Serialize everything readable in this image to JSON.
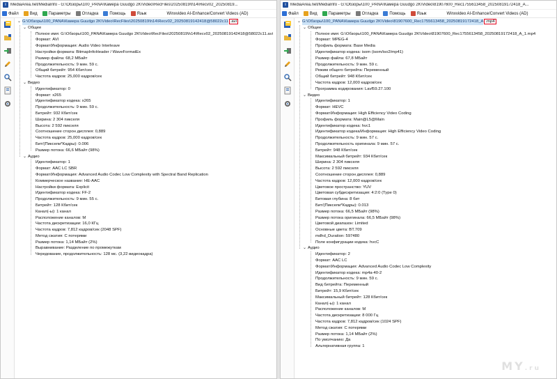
{
  "menu": [
    "Файл",
    "Вид",
    "Параметры",
    "Отладка",
    "Помощь",
    "Язык"
  ],
  "menu_extra": "Winxvideo AI-Enhance/Convert Videos (AD)",
  "watermark": "MY",
  "watermark_sub": ".ru",
  "left": {
    "title": "MediaArea.net/MediaInfo - G:\\Обзоры\\100_PANA\\Камера Guudgo 2K\\Video\\RecFiles\\20250819\\h14\\Recv02_20250819...",
    "file": {
      "path": "G:\\Обзоры\\100_PANA\\Камера Guudgo 2K\\Video\\RecFiles\\20250819\\h14\\Recv02_20250819142418@58022c11",
      "ext": ".avi"
    },
    "sections": [
      {
        "name": "Общее",
        "fields": [
          "Полное имя: G:\\Обзоры\\100_PANA\\Камера Guudgo 2K\\Video\\RecFiles\\20250819\\h14\\Recv02_20250819142418@58022c11.avi",
          "Формат: AVI",
          "Формат/Информация: Audio Video Interleave",
          "Настройки формата: BitmapInfoHeader / WaveFormatEx",
          "Размер файла: 68,2 МБайт",
          "Продолжительность: 9 мин. 59 с.",
          "Общий битрейт: 954 Кбит/сек",
          "Частота кадров: 25,000 кадров/сек"
        ]
      },
      {
        "name": "Видео",
        "fields": [
          "Идентификатор: 0",
          "Формат: x265",
          "Идентификатор кодека: x265",
          "Продолжительность: 9 мин. 59 с.",
          "Битрейт: 932 Кбит/сек",
          "Ширина: 2 304 пикселя",
          "Высота: 2 592 пикселя",
          "Соотношение сторон дисплея: 0,889",
          "Частота кадров: 25,000 кадров/сек",
          "Бит/(Пиксели*Кадры): 0.006",
          "Размер потока: 66,6 МБайт (98%)"
        ]
      },
      {
        "name": "Аудио",
        "fields": [
          "Идентификатор: 1",
          "Формат: AAC LC SBR",
          "Формат/Информация: Advanced Audio Codec Low Complexity with Spectral Band Replication",
          "Коммерческое название: HE-AAC",
          "Настройки формата: Explicit",
          "Идентификатор кодека: FF-2",
          "Продолжительность: 9 мин. 55 с.",
          "Битрейт: 128 Кбит/сек",
          "Канал(-ы): 1 канал",
          "Расположение каналов: M",
          "Частота дискретизации: 16,0 КГц",
          "Частота кадров: 7,812 кадров/сек (2048 SPF)",
          "Метод сжатия: С потерями",
          "Размер потока: 1,14 МБайт (2%)",
          "Выравнивание: Разделение по промежуткам",
          "Чередование, продолжительность: 128 мс. (3,22 видеокадра)"
        ]
      }
    ]
  },
  "right": {
    "title": "MediaArea.net/MediaInfo - G:\\Обзоры\\100_PANA\\Камера Guudgo 2K\\Video\\81907600_Rec1755613458_20250819172418_A...",
    "file": {
      "path": "G:\\Обзоры\\100_PANA\\Камера Guudgo 2K\\Video\\81907600_Rec1755613458_20250819172418_A",
      "ext": ".mp4"
    },
    "sections": [
      {
        "name": "Общее",
        "fields": [
          "Полное имя: G:\\Обзоры\\100_PANA\\Камера Guudgo 2K\\Video\\81907600_Rec1755613458_20250819172418_A_1.mp4",
          "Формат: MPEG-4",
          "Профиль формата: Base Media",
          "Идентификатор кодека: isom (isom/iso2/mp41)",
          "Размер файла: 67,8 МБайт",
          "Продолжительность: 9 мин. 59 с.",
          "Режим общего битрейта: Переменный",
          "Общий битрейт: 948 Кбит/сек",
          "Частота кадров: 12,000 кадров/сек",
          "Программа кодирования: Lavf59.27.100"
        ]
      },
      {
        "name": "Видео",
        "fields": [
          "Идентификатор: 1",
          "Формат: HEVC",
          "Формат/Информация: High Efficiency Video Coding",
          "Профиль формата: Main@L5@Main",
          "Идентификатор кодека: hvc1",
          "Идентификатор кодека/Информация: High Efficiency Video Coding",
          "Продолжительность: 9 мин. 57 с.",
          "Продолжительность оригинала: 9 мин. 57 с.",
          "Битрейт: 948 Кбит/сек",
          "Максимальный битрейт: 934 Кбит/сек",
          "Ширина: 2 304 пикселя",
          "Высота: 2 592 пикселя",
          "Соотношение сторон дисплея: 0,889",
          "Частота кадров: 12,000 кадров/сек",
          "Цветовое пространство: YUV",
          "Цветовая субдискретизация: 4:2:0 (Type 0)",
          "Битовая глубина: 8 бит",
          "Бит/(Пиксели*Кадры): 0.013",
          "Размер потока: 66,5 МБайт (98%)",
          "Размер потока оригинала: 66,5 МБайт (98%)",
          "Цветовой диапазон: Limited",
          "Основные цвета: BT.709",
          "mdhd_Duration: 597480",
          "Поле конфигурации кодека: hvcC"
        ]
      },
      {
        "name": "Аудио",
        "fields": [
          "Идентификатор: 2",
          "Формат: AAC LC",
          "Формат/Информация: Advanced Audio Codec Low Complexity",
          "Идентификатор кодека: mp4a-40-2",
          "Продолжительность: 9 мин. 59 с.",
          "Вид битрейта: Переменный",
          "Битрейт: 15,9 Кбит/сек",
          "Максимальный битрейт: 128 Кбит/сек",
          "Канал(-ы): 1 канал",
          "Расположение каналов: M",
          "Частота дискретизации: 8 000 Гц",
          "Частота кадров: 7,812 кадров/сек (1024 SPF)",
          "Метод сжатия: С потерями",
          "Размер потока: 1,14 МБайт (2%)",
          "По умолчанию: Да",
          "Альтернативная группа: 1"
        ]
      }
    ]
  }
}
